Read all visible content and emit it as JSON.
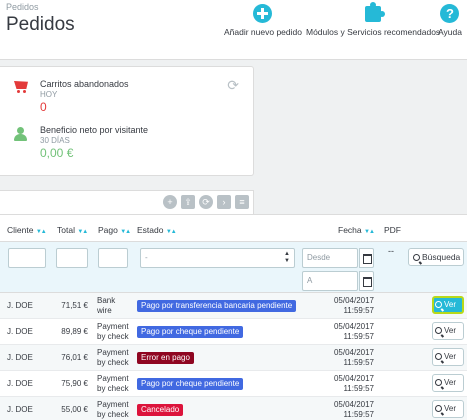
{
  "header": {
    "breadcrumb": "Pedidos",
    "title": "Pedidos",
    "toolbar": {
      "add_order": "Añadir nuevo pedido",
      "modules": "Módulos y Servicios recomendados",
      "help": "Ayuda"
    }
  },
  "kpis": {
    "abandoned_carts": {
      "title": "Carritos abandonados",
      "period": "HOY",
      "value": "0",
      "color": "#e33a3a"
    },
    "net_profit": {
      "title": "Beneficio neto por visitante",
      "period": "30 DÍAS",
      "value": "0,00 €",
      "color": "#72c279"
    }
  },
  "table": {
    "columns": {
      "client": "Cliente",
      "total": "Total",
      "payment": "Pago",
      "status": "Estado",
      "date": "Fecha",
      "pdf": "PDF"
    },
    "filters": {
      "status_value": "-",
      "date_from_placeholder": "Desde",
      "date_to_placeholder": "A",
      "pdf_value": "--",
      "search_label": "Búsqueda"
    },
    "rows": [
      {
        "client": "J. DOE",
        "total": "71,51 €",
        "payment_1": "Bank",
        "payment_2": "wire",
        "status": "Pago por transferencia bancaria pendiente",
        "status_color": "#4169e1",
        "date": "05/04/2017",
        "time": "11:59:57",
        "action": "Ver",
        "active": true
      },
      {
        "client": "J. DOE",
        "total": "89,89 €",
        "payment_1": "Payment",
        "payment_2": "by check",
        "status": "Pago por cheque pendiente",
        "status_color": "#4169e1",
        "date": "05/04/2017",
        "time": "11:59:57",
        "action": "Ver",
        "active": false
      },
      {
        "client": "J. DOE",
        "total": "76,01 €",
        "payment_1": "Payment",
        "payment_2": "by check",
        "status": "Error en pago",
        "status_color": "#8f0621",
        "date": "05/04/2017",
        "time": "11:59:57",
        "action": "Ver",
        "active": false
      },
      {
        "client": "J. DOE",
        "total": "75,90 €",
        "payment_1": "Payment",
        "payment_2": "by check",
        "status": "Pago por cheque pendiente",
        "status_color": "#4169e1",
        "date": "05/04/2017",
        "time": "11:59:57",
        "action": "Ver",
        "active": false
      },
      {
        "client": "J. DOE",
        "total": "55,00 €",
        "payment_1": "Payment",
        "payment_2": "by check",
        "status": "Cancelado",
        "status_color": "#dc143c",
        "date": "05/04/2017",
        "time": "11:59:57",
        "action": "Ver",
        "active": false
      }
    ]
  }
}
